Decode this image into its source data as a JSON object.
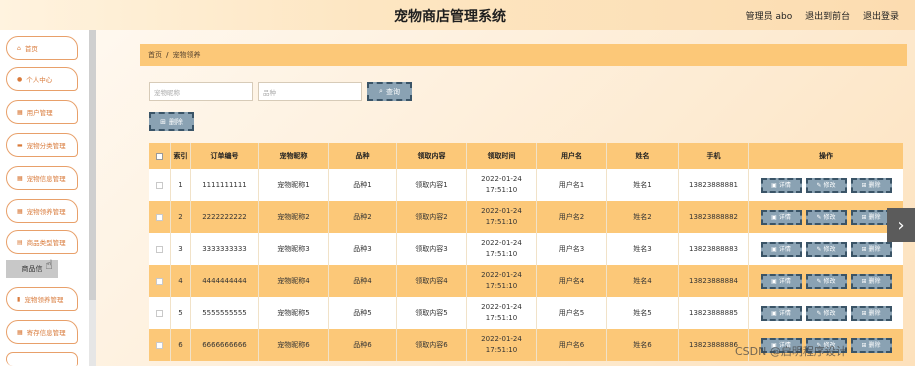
{
  "header": {
    "title": "宠物商店管理系统",
    "user": "管理员 abo",
    "back_front": "退出到前台",
    "logout": "退出登录"
  },
  "sidebar": {
    "items": [
      {
        "label": "首页",
        "icon": "home-icon"
      },
      {
        "label": "个人中心",
        "icon": "user-icon"
      },
      {
        "label": "用户管理",
        "icon": "grid-icon"
      },
      {
        "label": "宠物分类管理",
        "icon": "message-icon"
      },
      {
        "label": "宠物信息管理",
        "icon": "grid-icon"
      },
      {
        "label": "宠物领养管理",
        "icon": "grid-icon"
      },
      {
        "label": "商品类型管理",
        "icon": "doc-icon"
      }
    ],
    "active": "商品信",
    "more_items": [
      {
        "label": "宠物领养管理",
        "icon": "chart-icon"
      },
      {
        "label": "寄存信息管理",
        "icon": "grid-icon"
      }
    ]
  },
  "breadcrumb": {
    "home": "首页",
    "sep": "/",
    "current": "宠物领养"
  },
  "search": {
    "name_placeholder": "宠物昵称",
    "breed_placeholder": "品种",
    "query_label": "查询"
  },
  "toolbar": {
    "delete_label": "删除"
  },
  "table": {
    "headers": [
      "",
      "索引",
      "订单编号",
      "宠物昵称",
      "品种",
      "领取内容",
      "领取时间",
      "用户名",
      "姓名",
      "手机",
      "操作"
    ],
    "rows": [
      {
        "idx": "1",
        "order": "1111111111",
        "pet": "宠物昵称1",
        "breed": "品种1",
        "content": "领取内容1",
        "time": "2022-01-24 17:51:10",
        "user": "用户名1",
        "name": "姓名1",
        "phone": "13823888881"
      },
      {
        "idx": "2",
        "order": "2222222222",
        "pet": "宠物昵称2",
        "breed": "品种2",
        "content": "领取内容2",
        "time": "2022-01-24 17:51:10",
        "user": "用户名2",
        "name": "姓名2",
        "phone": "13823888882"
      },
      {
        "idx": "3",
        "order": "3333333333",
        "pet": "宠物昵称3",
        "breed": "品种3",
        "content": "领取内容3",
        "time": "2022-01-24 17:51:10",
        "user": "用户名3",
        "name": "姓名3",
        "phone": "13823888883"
      },
      {
        "idx": "4",
        "order": "4444444444",
        "pet": "宠物昵称4",
        "breed": "品种4",
        "content": "领取内容4",
        "time": "2022-01-24 17:51:10",
        "user": "用户名4",
        "name": "姓名4",
        "phone": "13823888884"
      },
      {
        "idx": "5",
        "order": "5555555555",
        "pet": "宠物昵称5",
        "breed": "品种5",
        "content": "领取内容5",
        "time": "2022-01-24 17:51:10",
        "user": "用户名5",
        "name": "姓名5",
        "phone": "13823888885"
      },
      {
        "idx": "6",
        "order": "6666666666",
        "pet": "宠物昵称6",
        "breed": "品种6",
        "content": "领取内容6",
        "time": "2022-01-24 17:51:10",
        "user": "用户名6",
        "name": "姓名6",
        "phone": "13823888886"
      }
    ],
    "actions": {
      "detail": "详情",
      "edit": "修改",
      "delete": "删除"
    }
  },
  "watermark": "CSDN @启明程序设计"
}
